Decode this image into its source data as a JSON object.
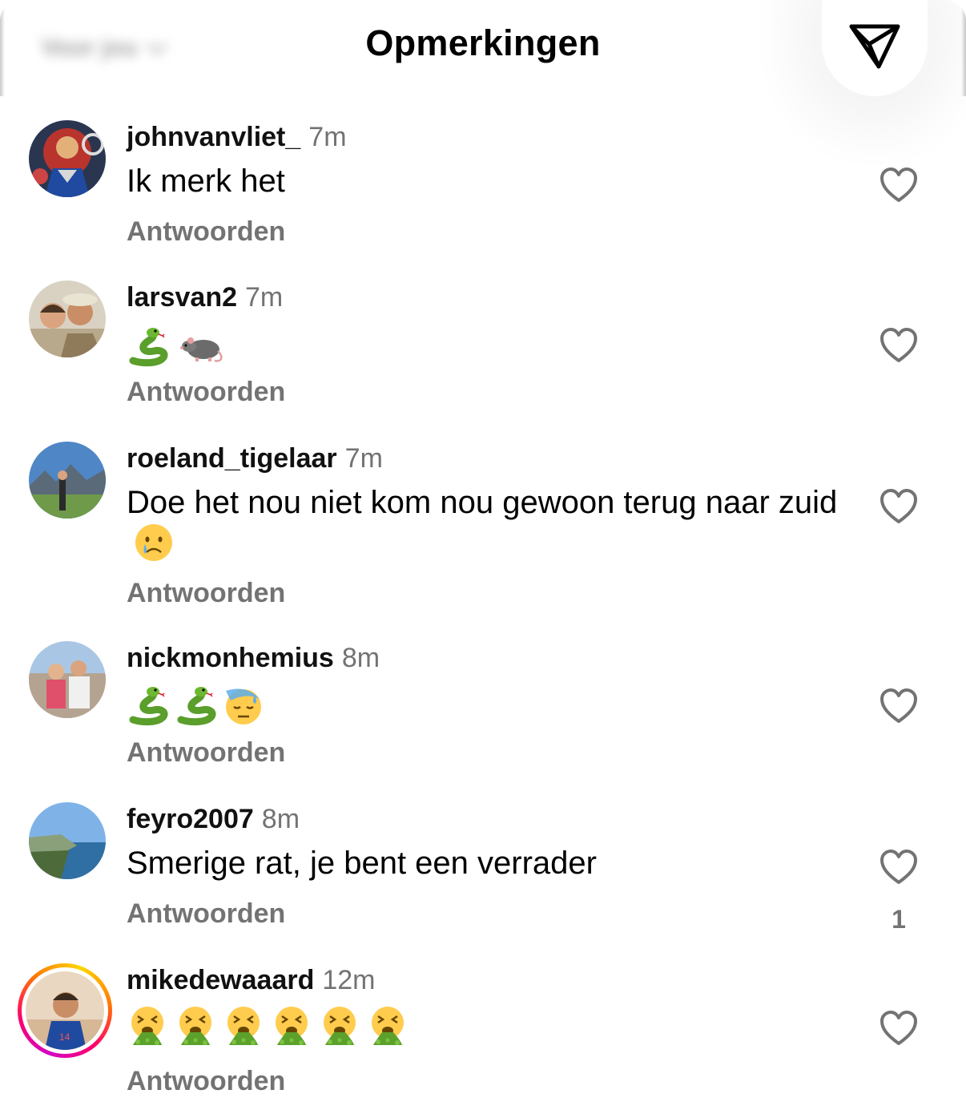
{
  "header": {
    "sort_label": "Voor jou",
    "title": "Opmerkingen",
    "share_icon": "paper-plane-icon"
  },
  "comments": [
    {
      "username": "johnvanvliet_",
      "time": "7m",
      "text": "Ik merk het",
      "emojis": [],
      "reply_label": "Antwoorden",
      "likes": ""
    },
    {
      "username": "larsvan2",
      "time": "7m",
      "text": "",
      "emojis": [
        "snake",
        "rat"
      ],
      "reply_label": "Antwoorden",
      "likes": ""
    },
    {
      "username": "roeland_tigelaar",
      "time": "7m",
      "text": "Doe het nou niet kom nou gewoon terug naar zuid",
      "emojis": [
        "crying-face"
      ],
      "reply_label": "Antwoorden",
      "likes": ""
    },
    {
      "username": "nickmonhemius",
      "time": "8m",
      "text": "",
      "emojis": [
        "snake",
        "snake",
        "downcast-sweat-face"
      ],
      "reply_label": "Antwoorden",
      "likes": ""
    },
    {
      "username": "feyro2007",
      "time": "8m",
      "text": "Smerige rat, je bent een verrader",
      "emojis": [],
      "reply_label": "Antwoorden",
      "likes": "1"
    },
    {
      "username": "mikedewaaard",
      "time": "12m",
      "text": "",
      "emojis": [
        "vomiting-face",
        "vomiting-face",
        "vomiting-face",
        "vomiting-face",
        "vomiting-face",
        "vomiting-face"
      ],
      "reply_label": "Antwoorden",
      "likes": "",
      "has_story_ring": true
    }
  ],
  "colors": {
    "secondary_text": "#737373",
    "primary_text": "#000000",
    "story_ring": [
      "#d300c5",
      "#ff0069",
      "#ffd600"
    ]
  }
}
